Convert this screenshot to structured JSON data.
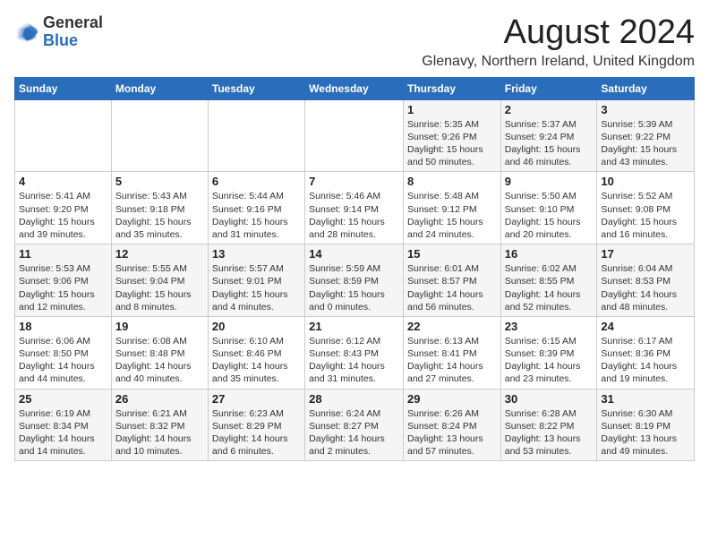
{
  "logo": {
    "general": "General",
    "blue": "Blue"
  },
  "title": "August 2024",
  "location": "Glenavy, Northern Ireland, United Kingdom",
  "days_of_week": [
    "Sunday",
    "Monday",
    "Tuesday",
    "Wednesday",
    "Thursday",
    "Friday",
    "Saturday"
  ],
  "weeks": [
    [
      {
        "num": "",
        "info": ""
      },
      {
        "num": "",
        "info": ""
      },
      {
        "num": "",
        "info": ""
      },
      {
        "num": "",
        "info": ""
      },
      {
        "num": "1",
        "info": "Sunrise: 5:35 AM\nSunset: 9:26 PM\nDaylight: 15 hours\nand 50 minutes."
      },
      {
        "num": "2",
        "info": "Sunrise: 5:37 AM\nSunset: 9:24 PM\nDaylight: 15 hours\nand 46 minutes."
      },
      {
        "num": "3",
        "info": "Sunrise: 5:39 AM\nSunset: 9:22 PM\nDaylight: 15 hours\nand 43 minutes."
      }
    ],
    [
      {
        "num": "4",
        "info": "Sunrise: 5:41 AM\nSunset: 9:20 PM\nDaylight: 15 hours\nand 39 minutes."
      },
      {
        "num": "5",
        "info": "Sunrise: 5:43 AM\nSunset: 9:18 PM\nDaylight: 15 hours\nand 35 minutes."
      },
      {
        "num": "6",
        "info": "Sunrise: 5:44 AM\nSunset: 9:16 PM\nDaylight: 15 hours\nand 31 minutes."
      },
      {
        "num": "7",
        "info": "Sunrise: 5:46 AM\nSunset: 9:14 PM\nDaylight: 15 hours\nand 28 minutes."
      },
      {
        "num": "8",
        "info": "Sunrise: 5:48 AM\nSunset: 9:12 PM\nDaylight: 15 hours\nand 24 minutes."
      },
      {
        "num": "9",
        "info": "Sunrise: 5:50 AM\nSunset: 9:10 PM\nDaylight: 15 hours\nand 20 minutes."
      },
      {
        "num": "10",
        "info": "Sunrise: 5:52 AM\nSunset: 9:08 PM\nDaylight: 15 hours\nand 16 minutes."
      }
    ],
    [
      {
        "num": "11",
        "info": "Sunrise: 5:53 AM\nSunset: 9:06 PM\nDaylight: 15 hours\nand 12 minutes."
      },
      {
        "num": "12",
        "info": "Sunrise: 5:55 AM\nSunset: 9:04 PM\nDaylight: 15 hours\nand 8 minutes."
      },
      {
        "num": "13",
        "info": "Sunrise: 5:57 AM\nSunset: 9:01 PM\nDaylight: 15 hours\nand 4 minutes."
      },
      {
        "num": "14",
        "info": "Sunrise: 5:59 AM\nSunset: 8:59 PM\nDaylight: 15 hours\nand 0 minutes."
      },
      {
        "num": "15",
        "info": "Sunrise: 6:01 AM\nSunset: 8:57 PM\nDaylight: 14 hours\nand 56 minutes."
      },
      {
        "num": "16",
        "info": "Sunrise: 6:02 AM\nSunset: 8:55 PM\nDaylight: 14 hours\nand 52 minutes."
      },
      {
        "num": "17",
        "info": "Sunrise: 6:04 AM\nSunset: 8:53 PM\nDaylight: 14 hours\nand 48 minutes."
      }
    ],
    [
      {
        "num": "18",
        "info": "Sunrise: 6:06 AM\nSunset: 8:50 PM\nDaylight: 14 hours\nand 44 minutes."
      },
      {
        "num": "19",
        "info": "Sunrise: 6:08 AM\nSunset: 8:48 PM\nDaylight: 14 hours\nand 40 minutes."
      },
      {
        "num": "20",
        "info": "Sunrise: 6:10 AM\nSunset: 8:46 PM\nDaylight: 14 hours\nand 35 minutes."
      },
      {
        "num": "21",
        "info": "Sunrise: 6:12 AM\nSunset: 8:43 PM\nDaylight: 14 hours\nand 31 minutes."
      },
      {
        "num": "22",
        "info": "Sunrise: 6:13 AM\nSunset: 8:41 PM\nDaylight: 14 hours\nand 27 minutes."
      },
      {
        "num": "23",
        "info": "Sunrise: 6:15 AM\nSunset: 8:39 PM\nDaylight: 14 hours\nand 23 minutes."
      },
      {
        "num": "24",
        "info": "Sunrise: 6:17 AM\nSunset: 8:36 PM\nDaylight: 14 hours\nand 19 minutes."
      }
    ],
    [
      {
        "num": "25",
        "info": "Sunrise: 6:19 AM\nSunset: 8:34 PM\nDaylight: 14 hours\nand 14 minutes."
      },
      {
        "num": "26",
        "info": "Sunrise: 6:21 AM\nSunset: 8:32 PM\nDaylight: 14 hours\nand 10 minutes."
      },
      {
        "num": "27",
        "info": "Sunrise: 6:23 AM\nSunset: 8:29 PM\nDaylight: 14 hours\nand 6 minutes."
      },
      {
        "num": "28",
        "info": "Sunrise: 6:24 AM\nSunset: 8:27 PM\nDaylight: 14 hours\nand 2 minutes."
      },
      {
        "num": "29",
        "info": "Sunrise: 6:26 AM\nSunset: 8:24 PM\nDaylight: 13 hours\nand 57 minutes."
      },
      {
        "num": "30",
        "info": "Sunrise: 6:28 AM\nSunset: 8:22 PM\nDaylight: 13 hours\nand 53 minutes."
      },
      {
        "num": "31",
        "info": "Sunrise: 6:30 AM\nSunset: 8:19 PM\nDaylight: 13 hours\nand 49 minutes."
      }
    ]
  ]
}
